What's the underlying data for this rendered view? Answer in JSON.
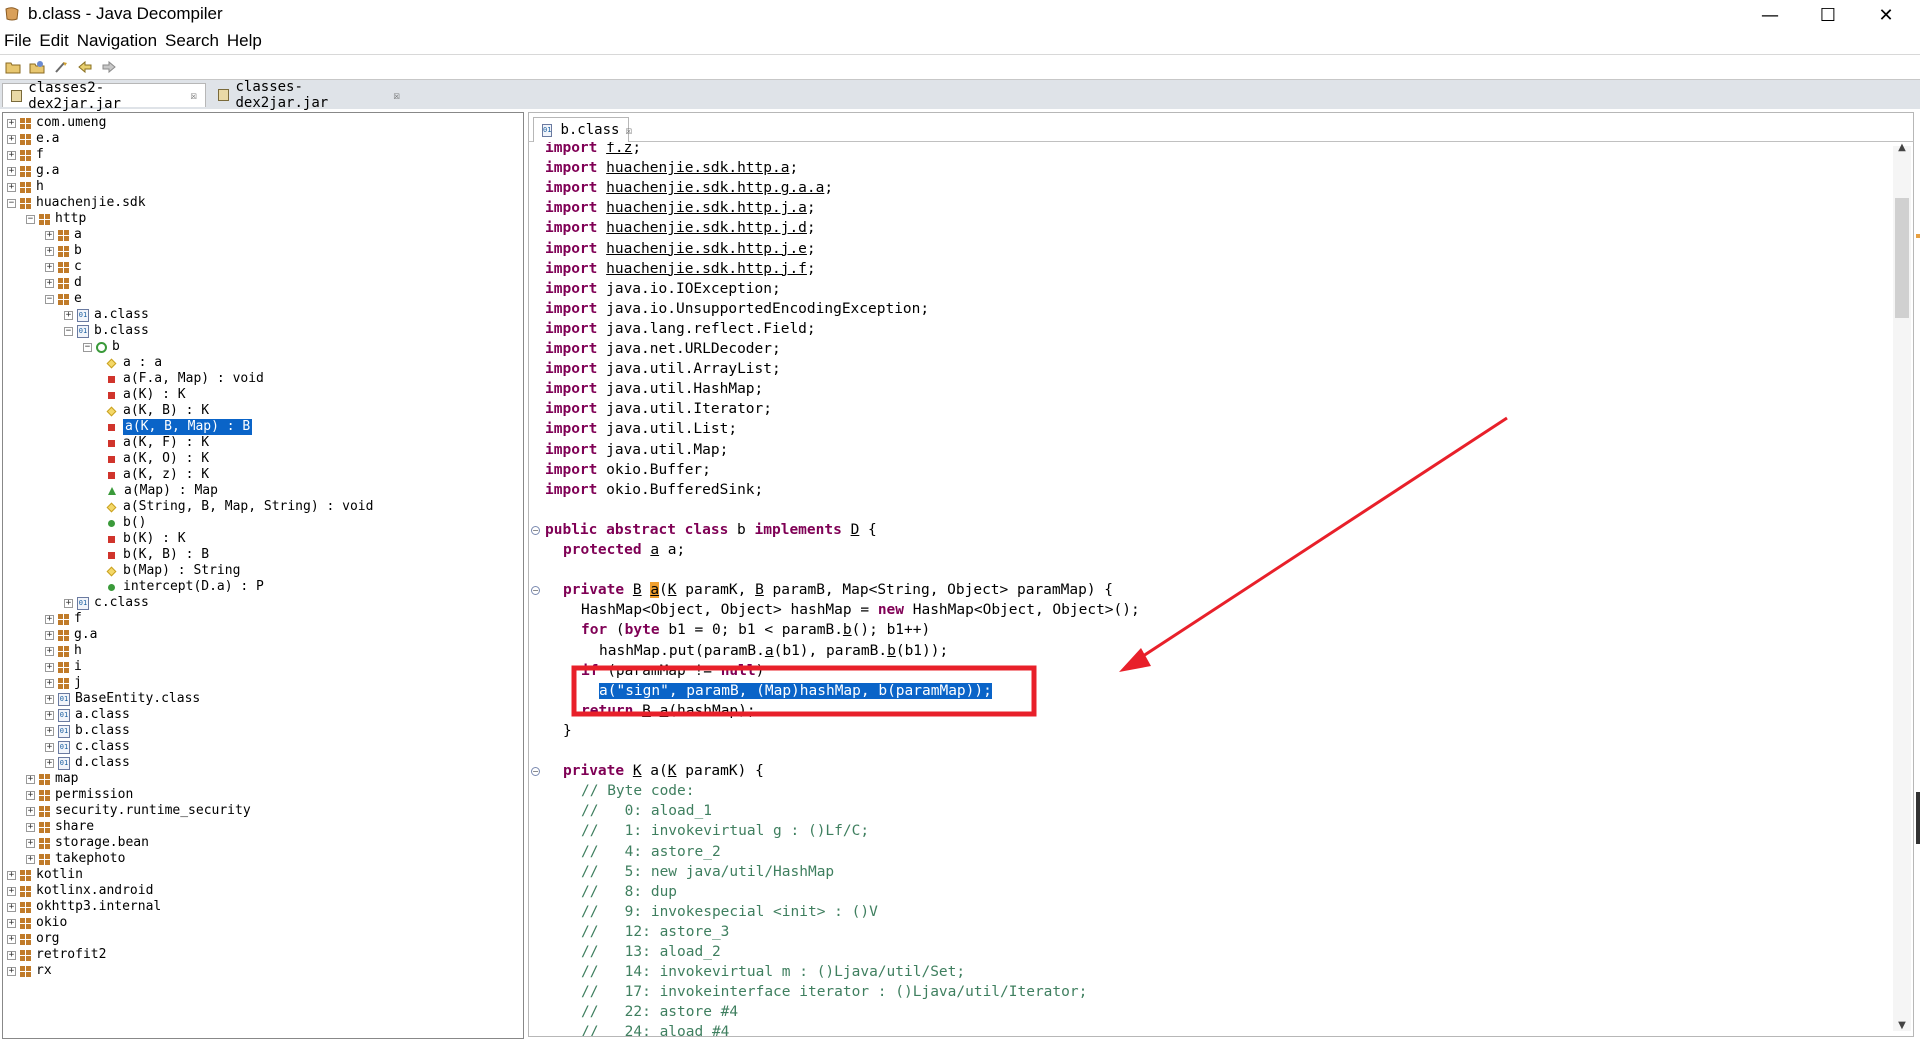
{
  "window": {
    "title": "b.class - Java Decompiler",
    "minimize": "—",
    "maximize": "☐",
    "close": "✕"
  },
  "menu": [
    "File",
    "Edit",
    "Navigation",
    "Search",
    "Help"
  ],
  "outer_tabs": [
    {
      "label": "classes2-dex2jar.jar",
      "close": "☒"
    },
    {
      "label": "classes-dex2jar.jar",
      "close": "☒"
    }
  ],
  "editor_tab": {
    "label": "b.class",
    "close": "☒"
  },
  "tree": [
    {
      "depth": 0,
      "exp": "+",
      "icon": "pkg",
      "label": "com.umeng"
    },
    {
      "depth": 0,
      "exp": "+",
      "icon": "pkg",
      "label": "e.a"
    },
    {
      "depth": 0,
      "exp": "+",
      "icon": "pkg",
      "label": "f"
    },
    {
      "depth": 0,
      "exp": "+",
      "icon": "pkg",
      "label": "g.a"
    },
    {
      "depth": 0,
      "exp": "+",
      "icon": "pkg",
      "label": "h"
    },
    {
      "depth": 0,
      "exp": "−",
      "icon": "pkg",
      "label": "huachenjie.sdk"
    },
    {
      "depth": 1,
      "exp": "−",
      "icon": "pkg",
      "label": "http"
    },
    {
      "depth": 2,
      "exp": "+",
      "icon": "pkg",
      "label": "a"
    },
    {
      "depth": 2,
      "exp": "+",
      "icon": "pkg",
      "label": "b"
    },
    {
      "depth": 2,
      "exp": "+",
      "icon": "pkg",
      "label": "c"
    },
    {
      "depth": 2,
      "exp": "+",
      "icon": "pkg",
      "label": "d"
    },
    {
      "depth": 2,
      "exp": "−",
      "icon": "pkg",
      "label": "e"
    },
    {
      "depth": 3,
      "exp": "+",
      "icon": "cls",
      "label": "a.class"
    },
    {
      "depth": 3,
      "exp": "−",
      "icon": "cls",
      "label": "b.class"
    },
    {
      "depth": 4,
      "exp": "−",
      "icon": "c",
      "label": "b"
    },
    {
      "depth": 5,
      "exp": "",
      "icon": "dia",
      "label": "a : a"
    },
    {
      "depth": 5,
      "exp": "",
      "icon": "red",
      "label": "a(F.a, Map) : void"
    },
    {
      "depth": 5,
      "exp": "",
      "icon": "red",
      "label": "a(K) : K"
    },
    {
      "depth": 5,
      "exp": "",
      "icon": "dia",
      "label": "a(K, B) : K"
    },
    {
      "depth": 5,
      "exp": "",
      "icon": "red",
      "label": "a(K, B, Map) : B",
      "selected": true
    },
    {
      "depth": 5,
      "exp": "",
      "icon": "red",
      "label": "a(K, F) : K"
    },
    {
      "depth": 5,
      "exp": "",
      "icon": "red",
      "label": "a(K, O) : K"
    },
    {
      "depth": 5,
      "exp": "",
      "icon": "red",
      "label": "a(K, z) : K"
    },
    {
      "depth": 5,
      "exp": "",
      "icon": "tri",
      "label": "a(Map) : Map"
    },
    {
      "depth": 5,
      "exp": "",
      "icon": "dia",
      "label": "a(String, B, Map, String) : void"
    },
    {
      "depth": 5,
      "exp": "",
      "icon": "grn",
      "label": "b()"
    },
    {
      "depth": 5,
      "exp": "",
      "icon": "red",
      "label": "b(K) : K"
    },
    {
      "depth": 5,
      "exp": "",
      "icon": "red",
      "label": "b(K, B) : B"
    },
    {
      "depth": 5,
      "exp": "",
      "icon": "dia",
      "label": "b(Map) : String"
    },
    {
      "depth": 5,
      "exp": "",
      "icon": "grn",
      "label": "intercept(D.a) : P"
    },
    {
      "depth": 3,
      "exp": "+",
      "icon": "cls",
      "label": "c.class"
    },
    {
      "depth": 2,
      "exp": "+",
      "icon": "pkg",
      "label": "f"
    },
    {
      "depth": 2,
      "exp": "+",
      "icon": "pkg",
      "label": "g.a"
    },
    {
      "depth": 2,
      "exp": "+",
      "icon": "pkg",
      "label": "h"
    },
    {
      "depth": 2,
      "exp": "+",
      "icon": "pkg",
      "label": "i"
    },
    {
      "depth": 2,
      "exp": "+",
      "icon": "pkg",
      "label": "j"
    },
    {
      "depth": 2,
      "exp": "+",
      "icon": "cls",
      "label": "BaseEntity.class"
    },
    {
      "depth": 2,
      "exp": "+",
      "icon": "cls",
      "label": "a.class"
    },
    {
      "depth": 2,
      "exp": "+",
      "icon": "cls",
      "label": "b.class"
    },
    {
      "depth": 2,
      "exp": "+",
      "icon": "cls",
      "label": "c.class"
    },
    {
      "depth": 2,
      "exp": "+",
      "icon": "cls",
      "label": "d.class"
    },
    {
      "depth": 1,
      "exp": "+",
      "icon": "pkg",
      "label": "map"
    },
    {
      "depth": 1,
      "exp": "+",
      "icon": "pkg",
      "label": "permission"
    },
    {
      "depth": 1,
      "exp": "+",
      "icon": "pkg",
      "label": "security.runtime_security"
    },
    {
      "depth": 1,
      "exp": "+",
      "icon": "pkg",
      "label": "share"
    },
    {
      "depth": 1,
      "exp": "+",
      "icon": "pkg",
      "label": "storage.bean"
    },
    {
      "depth": 1,
      "exp": "+",
      "icon": "pkg",
      "label": "takephoto"
    },
    {
      "depth": 0,
      "exp": "+",
      "icon": "pkg",
      "label": "kotlin"
    },
    {
      "depth": 0,
      "exp": "+",
      "icon": "pkg",
      "label": "kotlinx.android"
    },
    {
      "depth": 0,
      "exp": "+",
      "icon": "pkg",
      "label": "okhttp3.internal"
    },
    {
      "depth": 0,
      "exp": "+",
      "icon": "pkg",
      "label": "okio"
    },
    {
      "depth": 0,
      "exp": "+",
      "icon": "pkg",
      "label": "org"
    },
    {
      "depth": 0,
      "exp": "+",
      "icon": "pkg",
      "label": "retrofit2"
    },
    {
      "depth": 0,
      "exp": "+",
      "icon": "pkg",
      "label": "rx"
    }
  ],
  "code": [
    {
      "indent": 0,
      "parts": [
        [
          "kw",
          "import"
        ],
        [
          "t",
          " "
        ],
        [
          "ul",
          "f.z"
        ],
        [
          "t",
          ";"
        ]
      ]
    },
    {
      "indent": 0,
      "parts": [
        [
          "kw",
          "import"
        ],
        [
          "t",
          " "
        ],
        [
          "ul",
          "huachenjie.sdk.http.a"
        ],
        [
          "t",
          ";"
        ]
      ]
    },
    {
      "indent": 0,
      "parts": [
        [
          "kw",
          "import"
        ],
        [
          "t",
          " "
        ],
        [
          "ul",
          "huachenjie.sdk.http.g.a.a"
        ],
        [
          "t",
          ";"
        ]
      ]
    },
    {
      "indent": 0,
      "parts": [
        [
          "kw",
          "import"
        ],
        [
          "t",
          " "
        ],
        [
          "ul",
          "huachenjie.sdk.http.j.a"
        ],
        [
          "t",
          ";"
        ]
      ]
    },
    {
      "indent": 0,
      "parts": [
        [
          "kw",
          "import"
        ],
        [
          "t",
          " "
        ],
        [
          "ul",
          "huachenjie.sdk.http.j.d"
        ],
        [
          "t",
          ";"
        ]
      ]
    },
    {
      "indent": 0,
      "parts": [
        [
          "kw",
          "import"
        ],
        [
          "t",
          " "
        ],
        [
          "ul",
          "huachenjie.sdk.http.j.e"
        ],
        [
          "t",
          ";"
        ]
      ]
    },
    {
      "indent": 0,
      "parts": [
        [
          "kw",
          "import"
        ],
        [
          "t",
          " "
        ],
        [
          "ul",
          "huachenjie.sdk.http.j.f"
        ],
        [
          "t",
          ";"
        ]
      ]
    },
    {
      "indent": 0,
      "parts": [
        [
          "kw",
          "import"
        ],
        [
          "t",
          " java.io.IOException;"
        ]
      ]
    },
    {
      "indent": 0,
      "parts": [
        [
          "kw",
          "import"
        ],
        [
          "t",
          " java.io.UnsupportedEncodingException;"
        ]
      ]
    },
    {
      "indent": 0,
      "parts": [
        [
          "kw",
          "import"
        ],
        [
          "t",
          " java.lang.reflect.Field;"
        ]
      ]
    },
    {
      "indent": 0,
      "parts": [
        [
          "kw",
          "import"
        ],
        [
          "t",
          " java.net.URLDecoder;"
        ]
      ]
    },
    {
      "indent": 0,
      "parts": [
        [
          "kw",
          "import"
        ],
        [
          "t",
          " java.util.ArrayList;"
        ]
      ]
    },
    {
      "indent": 0,
      "parts": [
        [
          "kw",
          "import"
        ],
        [
          "t",
          " java.util.HashMap;"
        ]
      ]
    },
    {
      "indent": 0,
      "parts": [
        [
          "kw",
          "import"
        ],
        [
          "t",
          " java.util.Iterator;"
        ]
      ]
    },
    {
      "indent": 0,
      "parts": [
        [
          "kw",
          "import"
        ],
        [
          "t",
          " java.util.List;"
        ]
      ]
    },
    {
      "indent": 0,
      "parts": [
        [
          "kw",
          "import"
        ],
        [
          "t",
          " java.util.Map;"
        ]
      ]
    },
    {
      "indent": 0,
      "parts": [
        [
          "kw",
          "import"
        ],
        [
          "t",
          " okio.Buffer;"
        ]
      ]
    },
    {
      "indent": 0,
      "parts": [
        [
          "kw",
          "import"
        ],
        [
          "t",
          " okio.BufferedSink;"
        ]
      ]
    },
    {
      "indent": 0,
      "parts": []
    },
    {
      "indent": 0,
      "fold": true,
      "parts": [
        [
          "kw",
          "public abstract class"
        ],
        [
          "t",
          " b "
        ],
        [
          "kw",
          "implements"
        ],
        [
          "t",
          " "
        ],
        [
          "ul",
          "D"
        ],
        [
          "t",
          " {"
        ]
      ]
    },
    {
      "indent": 1,
      "parts": [
        [
          "kw",
          "protected"
        ],
        [
          "t",
          " "
        ],
        [
          "ul",
          "a"
        ],
        [
          "t",
          " a;"
        ]
      ]
    },
    {
      "indent": 0,
      "parts": []
    },
    {
      "indent": 1,
      "fold": true,
      "parts": [
        [
          "kw",
          "private"
        ],
        [
          "t",
          " "
        ],
        [
          "ul",
          "B"
        ],
        [
          "t",
          " "
        ],
        [
          "mark",
          "a"
        ],
        [
          "t",
          "("
        ],
        [
          "ul",
          "K"
        ],
        [
          "t",
          " paramK, "
        ],
        [
          "ul",
          "B"
        ],
        [
          "t",
          " paramB, Map<String, Object> paramMap) {"
        ]
      ]
    },
    {
      "indent": 2,
      "parts": [
        [
          "t",
          "HashMap<Object, Object> hashMap = "
        ],
        [
          "kw",
          "new"
        ],
        [
          "t",
          " HashMap<Object, Object>();"
        ]
      ]
    },
    {
      "indent": 2,
      "parts": [
        [
          "kw",
          "for"
        ],
        [
          "t",
          " ("
        ],
        [
          "kw",
          "byte"
        ],
        [
          "t",
          " b1 = 0; b1 < paramB."
        ],
        [
          "ul",
          "b"
        ],
        [
          "t",
          "(); b1++)"
        ]
      ]
    },
    {
      "indent": 3,
      "parts": [
        [
          "t",
          "hashMap.put(paramB."
        ],
        [
          "ul",
          "a"
        ],
        [
          "t",
          "(b1), paramB."
        ],
        [
          "ul",
          "b"
        ],
        [
          "t",
          "(b1));"
        ]
      ]
    },
    {
      "indent": 2,
      "parts": [
        [
          "kw",
          "if"
        ],
        [
          "t",
          " (paramMap != "
        ],
        [
          "kw",
          "null"
        ],
        [
          "t",
          ")"
        ]
      ]
    },
    {
      "indent": 3,
      "parts": [
        [
          "hl",
          "a(\"sign\", paramB, (Map)hashMap, b(paramMap));"
        ]
      ]
    },
    {
      "indent": 2,
      "parts": [
        [
          "kw",
          "return"
        ],
        [
          "t",
          " "
        ],
        [
          "ul",
          "B"
        ],
        [
          "t",
          "."
        ],
        [
          "ul",
          "a"
        ],
        [
          "t",
          "(hashMap);"
        ]
      ]
    },
    {
      "indent": 1,
      "parts": [
        [
          "t",
          "}"
        ]
      ]
    },
    {
      "indent": 0,
      "parts": []
    },
    {
      "indent": 1,
      "fold": true,
      "parts": [
        [
          "kw",
          "private"
        ],
        [
          "t",
          " "
        ],
        [
          "ul",
          "K"
        ],
        [
          "t",
          " a("
        ],
        [
          "ul",
          "K"
        ],
        [
          "t",
          " paramK) {"
        ]
      ]
    },
    {
      "indent": 2,
      "parts": [
        [
          "cm",
          "// Byte code:"
        ]
      ]
    },
    {
      "indent": 2,
      "parts": [
        [
          "cm",
          "//   0: aload_1"
        ]
      ]
    },
    {
      "indent": 2,
      "parts": [
        [
          "cm",
          "//   1: invokevirtual g : ()Lf/C;"
        ]
      ]
    },
    {
      "indent": 2,
      "parts": [
        [
          "cm",
          "//   4: astore_2"
        ]
      ]
    },
    {
      "indent": 2,
      "parts": [
        [
          "cm",
          "//   5: new java/util/HashMap"
        ]
      ]
    },
    {
      "indent": 2,
      "parts": [
        [
          "cm",
          "//   8: dup"
        ]
      ]
    },
    {
      "indent": 2,
      "parts": [
        [
          "cm",
          "//   9: invokespecial <init> : ()V"
        ]
      ]
    },
    {
      "indent": 2,
      "parts": [
        [
          "cm",
          "//   12: astore_3"
        ]
      ]
    },
    {
      "indent": 2,
      "parts": [
        [
          "cm",
          "//   13: aload_2"
        ]
      ]
    },
    {
      "indent": 2,
      "parts": [
        [
          "cm",
          "//   14: invokevirtual m : ()Ljava/util/Set;"
        ]
      ]
    },
    {
      "indent": 2,
      "parts": [
        [
          "cm",
          "//   17: invokeinterface iterator : ()Ljava/util/Iterator;"
        ]
      ]
    },
    {
      "indent": 2,
      "parts": [
        [
          "cm",
          "//   22: astore #4"
        ]
      ]
    },
    {
      "indent": 2,
      "parts": [
        [
          "cm",
          "//   24: aload #4"
        ]
      ]
    }
  ],
  "colors": {
    "selection": "#0a64c8",
    "keyword": "#7f0055",
    "comment": "#3f7f5f",
    "annotation": "#e8202a"
  }
}
